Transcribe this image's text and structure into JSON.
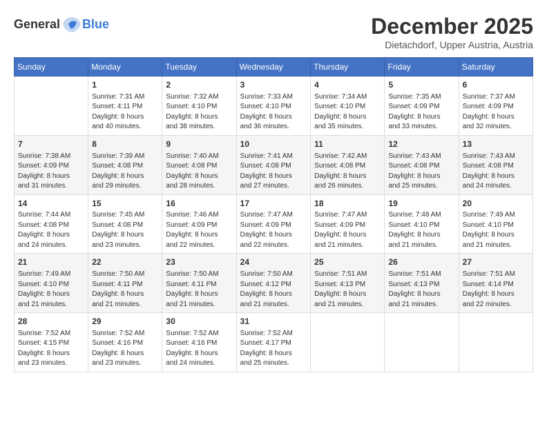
{
  "header": {
    "logo_general": "General",
    "logo_blue": "Blue",
    "month": "December 2025",
    "location": "Dietachdorf, Upper Austria, Austria"
  },
  "weekdays": [
    "Sunday",
    "Monday",
    "Tuesday",
    "Wednesday",
    "Thursday",
    "Friday",
    "Saturday"
  ],
  "weeks": [
    [
      {
        "day": "",
        "info": ""
      },
      {
        "day": "1",
        "info": "Sunrise: 7:31 AM\nSunset: 4:11 PM\nDaylight: 8 hours\nand 40 minutes."
      },
      {
        "day": "2",
        "info": "Sunrise: 7:32 AM\nSunset: 4:10 PM\nDaylight: 8 hours\nand 38 minutes."
      },
      {
        "day": "3",
        "info": "Sunrise: 7:33 AM\nSunset: 4:10 PM\nDaylight: 8 hours\nand 36 minutes."
      },
      {
        "day": "4",
        "info": "Sunrise: 7:34 AM\nSunset: 4:10 PM\nDaylight: 8 hours\nand 35 minutes."
      },
      {
        "day": "5",
        "info": "Sunrise: 7:35 AM\nSunset: 4:09 PM\nDaylight: 8 hours\nand 33 minutes."
      },
      {
        "day": "6",
        "info": "Sunrise: 7:37 AM\nSunset: 4:09 PM\nDaylight: 8 hours\nand 32 minutes."
      }
    ],
    [
      {
        "day": "7",
        "info": "Sunrise: 7:38 AM\nSunset: 4:09 PM\nDaylight: 8 hours\nand 31 minutes."
      },
      {
        "day": "8",
        "info": "Sunrise: 7:39 AM\nSunset: 4:08 PM\nDaylight: 8 hours\nand 29 minutes."
      },
      {
        "day": "9",
        "info": "Sunrise: 7:40 AM\nSunset: 4:08 PM\nDaylight: 8 hours\nand 28 minutes."
      },
      {
        "day": "10",
        "info": "Sunrise: 7:41 AM\nSunset: 4:08 PM\nDaylight: 8 hours\nand 27 minutes."
      },
      {
        "day": "11",
        "info": "Sunrise: 7:42 AM\nSunset: 4:08 PM\nDaylight: 8 hours\nand 26 minutes."
      },
      {
        "day": "12",
        "info": "Sunrise: 7:43 AM\nSunset: 4:08 PM\nDaylight: 8 hours\nand 25 minutes."
      },
      {
        "day": "13",
        "info": "Sunrise: 7:43 AM\nSunset: 4:08 PM\nDaylight: 8 hours\nand 24 minutes."
      }
    ],
    [
      {
        "day": "14",
        "info": "Sunrise: 7:44 AM\nSunset: 4:08 PM\nDaylight: 8 hours\nand 24 minutes."
      },
      {
        "day": "15",
        "info": "Sunrise: 7:45 AM\nSunset: 4:08 PM\nDaylight: 8 hours\nand 23 minutes."
      },
      {
        "day": "16",
        "info": "Sunrise: 7:46 AM\nSunset: 4:09 PM\nDaylight: 8 hours\nand 22 minutes."
      },
      {
        "day": "17",
        "info": "Sunrise: 7:47 AM\nSunset: 4:09 PM\nDaylight: 8 hours\nand 22 minutes."
      },
      {
        "day": "18",
        "info": "Sunrise: 7:47 AM\nSunset: 4:09 PM\nDaylight: 8 hours\nand 21 minutes."
      },
      {
        "day": "19",
        "info": "Sunrise: 7:48 AM\nSunset: 4:10 PM\nDaylight: 8 hours\nand 21 minutes."
      },
      {
        "day": "20",
        "info": "Sunrise: 7:49 AM\nSunset: 4:10 PM\nDaylight: 8 hours\nand 21 minutes."
      }
    ],
    [
      {
        "day": "21",
        "info": "Sunrise: 7:49 AM\nSunset: 4:10 PM\nDaylight: 8 hours\nand 21 minutes."
      },
      {
        "day": "22",
        "info": "Sunrise: 7:50 AM\nSunset: 4:11 PM\nDaylight: 8 hours\nand 21 minutes."
      },
      {
        "day": "23",
        "info": "Sunrise: 7:50 AM\nSunset: 4:11 PM\nDaylight: 8 hours\nand 21 minutes."
      },
      {
        "day": "24",
        "info": "Sunrise: 7:50 AM\nSunset: 4:12 PM\nDaylight: 8 hours\nand 21 minutes."
      },
      {
        "day": "25",
        "info": "Sunrise: 7:51 AM\nSunset: 4:13 PM\nDaylight: 8 hours\nand 21 minutes."
      },
      {
        "day": "26",
        "info": "Sunrise: 7:51 AM\nSunset: 4:13 PM\nDaylight: 8 hours\nand 21 minutes."
      },
      {
        "day": "27",
        "info": "Sunrise: 7:51 AM\nSunset: 4:14 PM\nDaylight: 8 hours\nand 22 minutes."
      }
    ],
    [
      {
        "day": "28",
        "info": "Sunrise: 7:52 AM\nSunset: 4:15 PM\nDaylight: 8 hours\nand 23 minutes."
      },
      {
        "day": "29",
        "info": "Sunrise: 7:52 AM\nSunset: 4:16 PM\nDaylight: 8 hours\nand 23 minutes."
      },
      {
        "day": "30",
        "info": "Sunrise: 7:52 AM\nSunset: 4:16 PM\nDaylight: 8 hours\nand 24 minutes."
      },
      {
        "day": "31",
        "info": "Sunrise: 7:52 AM\nSunset: 4:17 PM\nDaylight: 8 hours\nand 25 minutes."
      },
      {
        "day": "",
        "info": ""
      },
      {
        "day": "",
        "info": ""
      },
      {
        "day": "",
        "info": ""
      }
    ]
  ]
}
